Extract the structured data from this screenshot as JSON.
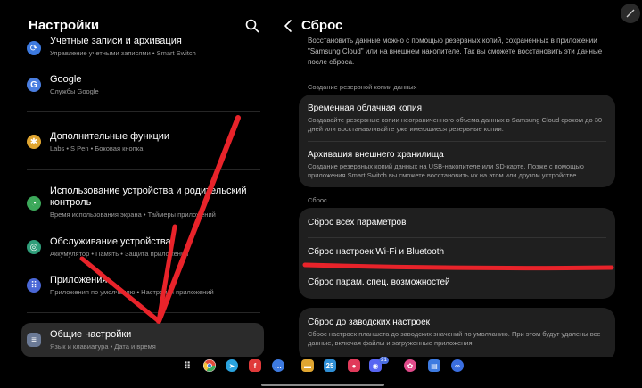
{
  "left": {
    "title": "Настройки",
    "items": [
      {
        "title": "Учетные записи и архивация",
        "subtitle": "Управление учетными записями • Smart Switch",
        "icon": "sync-icon",
        "color": "#3d7ae0"
      },
      {
        "title": "Google",
        "subtitle": "Службы Google",
        "icon": "google-icon",
        "color": "#4a7ee0"
      },
      {
        "title": "Дополнительные функции",
        "subtitle": "Labs • S Pen • Боковая кнопка",
        "icon": "puzzle-icon",
        "color": "#e0a530"
      },
      {
        "title": "Использование устройства и родительский контроль",
        "subtitle": "Время использования экрана • Таймеры приложений",
        "icon": "digital-wellbeing-icon",
        "color": "#3ca85a"
      },
      {
        "title": "Обслуживание устройства",
        "subtitle": "Аккумулятор • Память • Защита приложений",
        "icon": "device-care-icon",
        "color": "#2f9e7a"
      },
      {
        "title": "Приложения",
        "subtitle": "Приложения по умолчанию • Настройки приложений",
        "icon": "apps-grid-icon",
        "color": "#4a67d6"
      },
      {
        "title": "Общие настройки",
        "subtitle": "Язык и клавиатура • Дата и время",
        "icon": "sliders-icon",
        "color": "#6b7a96"
      }
    ]
  },
  "right": {
    "title": "Сброс",
    "intro": "Восстановить данные можно с помощью резервных копий, сохраненных в приложении \"Samsung Cloud\" или на внешнем накопителе. Так вы сможете восстановить эти данные после сброса.",
    "backup_label": "Создание резервной копии данных",
    "backup_items": [
      {
        "title": "Временная облачная копия",
        "subtitle": "Создавайте резервные копии неограниченного объема данных в Samsung Cloud сроком до 30 дней или восстанавливайте уже имеющиеся резервные копии."
      },
      {
        "title": "Архивация внешнего хранилища",
        "subtitle": "Создание резервных копий данных на USB-накопителе или SD-карте. Позже с помощью приложения Smart Switch вы сможете восстановить их на этом или другом устройстве."
      }
    ],
    "reset_label": "Сброс",
    "reset_items": [
      {
        "title": "Сброс всех параметров"
      },
      {
        "title": "Сброс настроек Wi-Fi и Bluetooth"
      },
      {
        "title": "Сброс парам. спец. возможностей"
      }
    ],
    "factory": {
      "title": "Сброс до заводских настроек",
      "subtitle": "Сброс настроек планшета до заводских значений по умолчанию. При этом будут удалены все данные, включая файлы и загруженные приложения."
    }
  },
  "dock": {
    "apps": [
      {
        "name": "apps-grid-icon",
        "label": "",
        "color": "#000000"
      },
      {
        "name": "chrome-icon",
        "label": "",
        "color": "#e0b030"
      },
      {
        "name": "telegram-icon",
        "label": "",
        "color": "#2aa3de"
      },
      {
        "name": "flipboard-icon",
        "label": "",
        "color": "#e03a3a"
      },
      {
        "name": "messages-icon",
        "label": "",
        "color": "#3d7ae0"
      },
      {
        "name": "files-icon",
        "label": "",
        "color": "#e0a530"
      },
      {
        "name": "calendar-icon",
        "label": "25",
        "color": "#2f8fd6"
      },
      {
        "name": "screen-recorder-icon",
        "label": "",
        "color": "#e03a5a"
      },
      {
        "name": "discord-icon",
        "label": "",
        "color": "#5865f2"
      },
      {
        "name": "bixby-icon",
        "label": "",
        "color": "#e04a8a"
      },
      {
        "name": "docs-icon",
        "label": "",
        "color": "#3d7ae0"
      },
      {
        "name": "link-icon",
        "label": "",
        "color": "#3a6ee0"
      }
    ],
    "discord_badge": "21"
  }
}
